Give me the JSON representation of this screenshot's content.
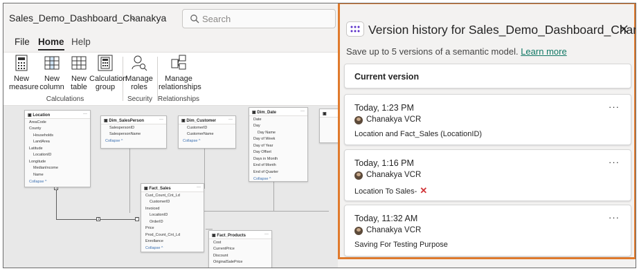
{
  "app": {
    "title": "Sales_Demo_Dashboard_Chanakya",
    "search_placeholder": "Search"
  },
  "menu": {
    "file": "File",
    "home": "Home",
    "help": "Help"
  },
  "ribbon": {
    "buttons": [
      {
        "line1": "New",
        "line2": "measure"
      },
      {
        "line1": "New",
        "line2": "column"
      },
      {
        "line1": "New",
        "line2": "table"
      },
      {
        "line1": "Calculation",
        "line2": "group"
      },
      {
        "line1": "Manage",
        "line2": "roles"
      },
      {
        "line1": "Manage",
        "line2": "relationships"
      }
    ],
    "groups": [
      "Calculations",
      "Security",
      "Relationships"
    ]
  },
  "model": {
    "location": {
      "name": "Location",
      "fields": [
        "AreaCode",
        "County",
        "Households",
        "LandArea",
        "Latitude",
        "LocationID",
        "Longitude",
        "MedianIncome",
        "Name"
      ],
      "collapse": "Collapse ^"
    },
    "salesperson": {
      "name": "Dim_SalesPerson",
      "fields": [
        "SalespersonID",
        "SalespersonName"
      ],
      "collapse": "Collapse ^"
    },
    "customer": {
      "name": "Dim_Customer",
      "fields": [
        "CustomerID",
        "CustomerName"
      ],
      "collapse": "Collapse ^"
    },
    "date": {
      "name": "Dim_Date",
      "fields": [
        "Date",
        "Day",
        "Day Name",
        "Day of Week",
        "Day of Year",
        "Day Offset",
        "Days in Month",
        "End of Month",
        "End of Quarter"
      ],
      "collapse": "Collapse ^"
    },
    "sales": {
      "name": "Fact_Sales",
      "fields": [
        "Cust_Count_Cnt_Ld",
        "CustomerID",
        "Invoiced",
        "LocationID",
        "OrderID",
        "Price",
        "Prod_Count_Cnt_Ld",
        "Enrollance"
      ],
      "collapse": "Collapse ^"
    },
    "products": {
      "name": "Fact_Products",
      "fields": [
        "Cost",
        "CurrentPrice",
        "Discount",
        "OriginalSalePrice"
      ]
    }
  },
  "panel": {
    "title": "Version history for Sales_Demo_Dashboard_Chan…",
    "subtitle": "Save up to 5 versions of a semantic model.",
    "learn_more": "Learn more",
    "current_version": "Current version",
    "versions": [
      {
        "time": "Today, 1:23 PM",
        "author": "Chanakya VCR",
        "description": "Location and Fact_Sales (LocationID)",
        "more": "···"
      },
      {
        "time": "Today, 1:16 PM",
        "author": "Chanakya VCR",
        "description": "Location To Sales-",
        "more": "···"
      },
      {
        "time": "Today, 11:32 AM",
        "author": "Chanakya VCR",
        "description": "Saving For Testing Purpose",
        "more": "···"
      }
    ],
    "accent": "#e07a2c"
  }
}
